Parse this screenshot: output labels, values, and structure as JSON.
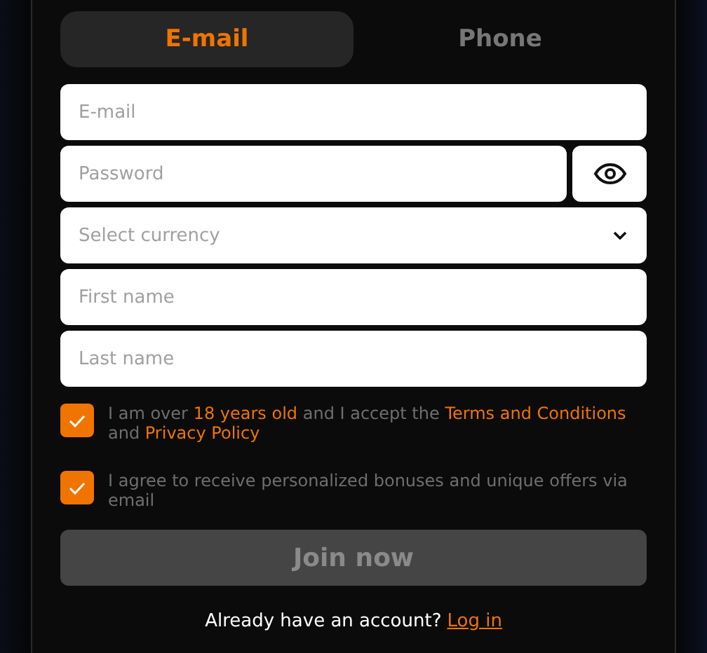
{
  "tabs": [
    {
      "label": "E-mail",
      "selected": true
    },
    {
      "label": "Phone",
      "selected": false
    }
  ],
  "fields": [
    {
      "kind": "text",
      "placeholder": "E-mail"
    },
    {
      "kind": "password",
      "placeholder": "Password"
    },
    {
      "kind": "select",
      "placeholder": "Select currency"
    },
    {
      "kind": "text",
      "placeholder": "First name"
    },
    {
      "kind": "text",
      "placeholder": "Last name"
    }
  ],
  "consents": [
    {
      "checked": true,
      "parts": [
        {
          "kind": "text",
          "text": "I am over"
        },
        {
          "kind": "link",
          "text": "18 years old"
        },
        {
          "kind": "text",
          "text": "and I accept the"
        },
        {
          "kind": "link",
          "text": "Terms and Conditions"
        },
        {
          "kind": "text",
          "text": "and"
        },
        {
          "kind": "link",
          "text": "Privacy Policy"
        }
      ]
    },
    {
      "checked": true,
      "parts": [
        {
          "kind": "text",
          "text": "I agree to receive personalized bonuses and unique offers via email"
        }
      ]
    }
  ],
  "submit": {
    "label": "Join now",
    "disabled": true
  },
  "footer": {
    "text": "Already have an account?",
    "link": "Log in"
  }
}
